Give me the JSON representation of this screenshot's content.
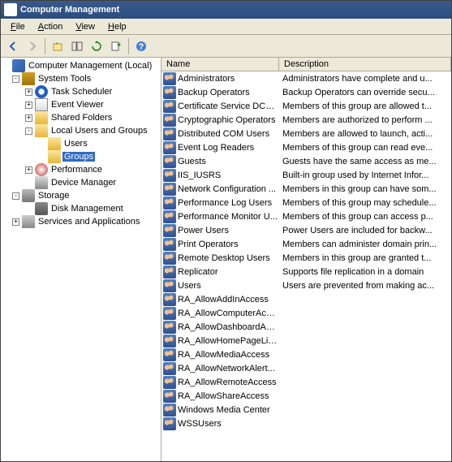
{
  "title": "Computer Management",
  "menu": [
    "File",
    "Action",
    "View",
    "Help"
  ],
  "tree": {
    "root": "Computer Management (Local)",
    "systemTools": "System Tools",
    "taskScheduler": "Task Scheduler",
    "eventViewer": "Event Viewer",
    "sharedFolders": "Shared Folders",
    "localUsers": "Local Users and Groups",
    "users": "Users",
    "groups": "Groups",
    "performance": "Performance",
    "devMgr": "Device Manager",
    "storage": "Storage",
    "diskMgmt": "Disk Management",
    "services": "Services and Applications"
  },
  "columns": {
    "name": "Name",
    "desc": "Description"
  },
  "groups": [
    {
      "name": "Administrators",
      "desc": "Administrators have complete and u..."
    },
    {
      "name": "Backup Operators",
      "desc": "Backup Operators can override secu..."
    },
    {
      "name": "Certificate Service DCO...",
      "desc": "Members of this group are allowed t..."
    },
    {
      "name": "Cryptographic Operators",
      "desc": "Members are authorized to perform ..."
    },
    {
      "name": "Distributed COM Users",
      "desc": "Members are allowed to launch, acti..."
    },
    {
      "name": "Event Log Readers",
      "desc": "Members of this group can read eve..."
    },
    {
      "name": "Guests",
      "desc": "Guests have the same access as me..."
    },
    {
      "name": "IIS_IUSRS",
      "desc": "Built-in group used by Internet Infor..."
    },
    {
      "name": "Network Configuration ...",
      "desc": "Members in this group can have som..."
    },
    {
      "name": "Performance Log Users",
      "desc": "Members of this group may schedule..."
    },
    {
      "name": "Performance Monitor U...",
      "desc": "Members of this group can access p..."
    },
    {
      "name": "Power Users",
      "desc": "Power Users are included for backw..."
    },
    {
      "name": "Print Operators",
      "desc": "Members can administer domain prin..."
    },
    {
      "name": "Remote Desktop Users",
      "desc": "Members in this group are granted t..."
    },
    {
      "name": "Replicator",
      "desc": "Supports file replication in a domain"
    },
    {
      "name": "Users",
      "desc": "Users are prevented from making ac..."
    },
    {
      "name": "RA_AllowAddInAccess",
      "desc": ""
    },
    {
      "name": "RA_AllowComputerAccess",
      "desc": ""
    },
    {
      "name": "RA_AllowDashboardAcc...",
      "desc": ""
    },
    {
      "name": "RA_AllowHomePageLinks",
      "desc": ""
    },
    {
      "name": "RA_AllowMediaAccess",
      "desc": ""
    },
    {
      "name": "RA_AllowNetworkAlert...",
      "desc": ""
    },
    {
      "name": "RA_AllowRemoteAccess",
      "desc": ""
    },
    {
      "name": "RA_AllowShareAccess",
      "desc": ""
    },
    {
      "name": "Windows Media Center",
      "desc": ""
    },
    {
      "name": "WSSUsers",
      "desc": ""
    }
  ]
}
